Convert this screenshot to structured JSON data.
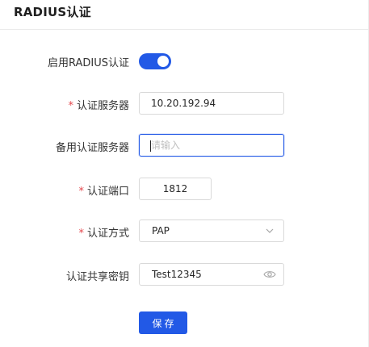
{
  "header": {
    "title": "RADIUS认证"
  },
  "form": {
    "enable_radius": {
      "label": "启用RADIUS认证",
      "enabled": true
    },
    "auth_server": {
      "label": "认证服务器",
      "required_mark": "*",
      "value": "10.20.192.94"
    },
    "backup_server": {
      "label": "备用认证服务器",
      "value": "",
      "placeholder": "请输入"
    },
    "auth_port": {
      "label": "认证端口",
      "required_mark": "*",
      "value": "1812"
    },
    "auth_method": {
      "label": "认证方式",
      "required_mark": "*",
      "value": "PAP",
      "icon": "chevron-down-icon"
    },
    "shared_secret": {
      "label": "认证共享密钥",
      "value": "Test12345",
      "icon": "eye-icon"
    },
    "save_label": "保存"
  },
  "colors": {
    "primary": "#2259e6",
    "required": "#e5484d",
    "border": "#d9d9d9"
  }
}
